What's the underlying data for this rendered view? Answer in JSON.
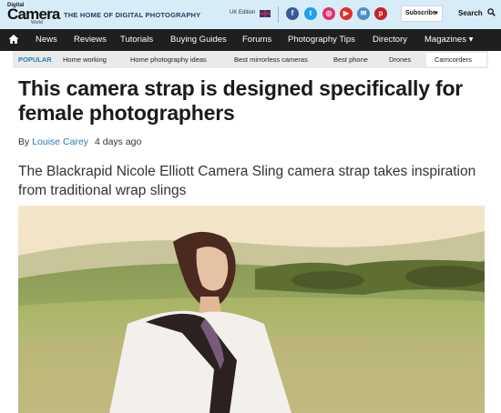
{
  "header": {
    "logo_small": "Digital",
    "logo_main": "Camera",
    "logo_sub": "World",
    "tagline": "THE HOME OF DIGITAL PHOTOGRAPHY",
    "edition": "UK Edition",
    "social": [
      {
        "icon": "facebook-icon",
        "glyph": "f",
        "color": "#3b5998"
      },
      {
        "icon": "twitter-icon",
        "glyph": "t",
        "color": "#1da1f2"
      },
      {
        "icon": "instagram-icon",
        "glyph": "◎",
        "color": "#e1306c"
      },
      {
        "icon": "youtube-icon",
        "glyph": "▶",
        "color": "#e52d27"
      },
      {
        "icon": "email-icon",
        "glyph": "✉",
        "color": "#4a90c8"
      },
      {
        "icon": "pinterest-icon",
        "glyph": "p",
        "color": "#cb2027"
      }
    ],
    "subscribe_label": "Subscribe",
    "search_label": "Search"
  },
  "nav": {
    "items": [
      "News",
      "Reviews",
      "Tutorials",
      "Buying Guides",
      "Forums",
      "Photography Tips",
      "Directory",
      "Magazines ▾"
    ]
  },
  "popular": {
    "label": "POPULAR",
    "items": [
      "Home working",
      "Home photography ideas",
      "Best mirrorless cameras",
      "Best phone",
      "Drones",
      "Camcorders"
    ]
  },
  "article": {
    "headline": "This camera strap is designed specifically for female photographers",
    "by": "By",
    "author": "Louise Carey",
    "time": "4 days ago",
    "standfirst": "The Blackrapid Nicole Elliott Camera Sling camera strap takes inspiration from traditional wrap slings"
  },
  "colors": {
    "topbar_bg": "#d6ecf7",
    "nav_bg": "#1f1f1f",
    "accent": "#2a7fb8"
  }
}
